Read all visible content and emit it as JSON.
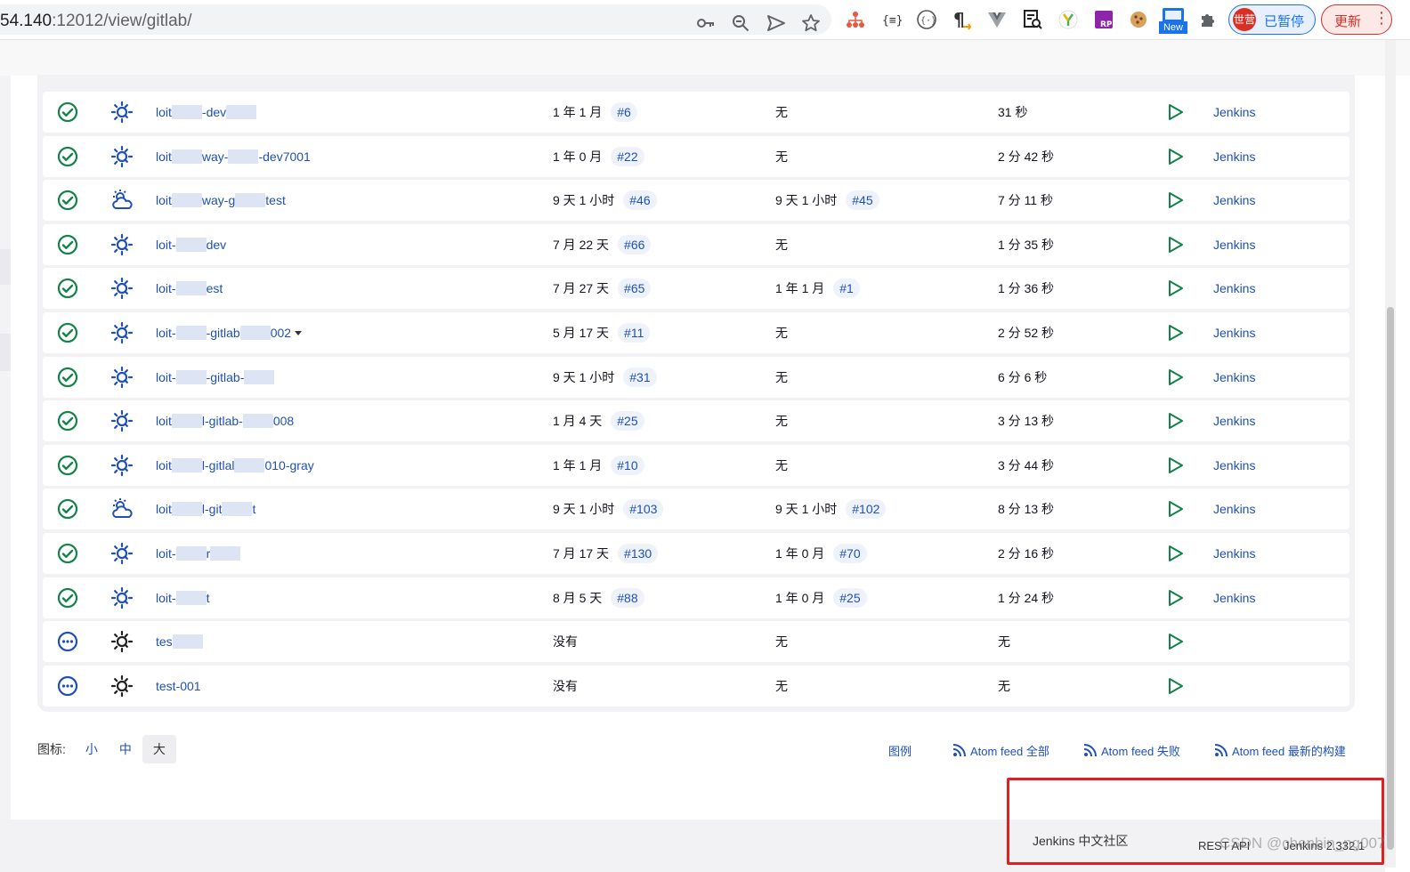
{
  "browser": {
    "url_host": "54.140",
    "url_rest": ":12012/view/gitlab/",
    "profile_avatar": "世营",
    "profile_label": "已暂停",
    "update_label": "更新",
    "ext_new_label": "New"
  },
  "jobs": [
    {
      "status": "success",
      "weather": "sunny",
      "name_parts": [
        "loit",
        "-dev",
        ""
      ],
      "last_success": "1 年 1 月",
      "last_success_build": "#6",
      "last_failure": "无",
      "last_failure_build": "",
      "duration": "31 秒",
      "node": "Jenkins"
    },
    {
      "status": "success",
      "weather": "sunny",
      "name_parts": [
        "loit",
        "way-",
        "-dev7001"
      ],
      "last_success": "1 年 0 月",
      "last_success_build": "#22",
      "last_failure": "无",
      "last_failure_build": "",
      "duration": "2 分 42 秒",
      "node": "Jenkins"
    },
    {
      "status": "success",
      "weather": "partly-cloudy",
      "name_parts": [
        "loit",
        "way-g",
        "test"
      ],
      "last_success": "9 天 1 小时",
      "last_success_build": "#46",
      "last_failure": "9 天 1 小时",
      "last_failure_build": "#45",
      "duration": "7 分 11 秒",
      "node": "Jenkins"
    },
    {
      "status": "success",
      "weather": "sunny",
      "name_parts": [
        "loit-",
        "dev"
      ],
      "last_success": "7 月 22 天",
      "last_success_build": "#66",
      "last_failure": "无",
      "last_failure_build": "",
      "duration": "1 分 35 秒",
      "node": "Jenkins"
    },
    {
      "status": "success",
      "weather": "sunny",
      "name_parts": [
        "loit-",
        "est"
      ],
      "last_success": "7 月 27 天",
      "last_success_build": "#65",
      "last_failure": "1 年 1 月",
      "last_failure_build": "#1",
      "duration": "1 分 36 秒",
      "node": "Jenkins"
    },
    {
      "status": "success",
      "weather": "sunny",
      "name_parts": [
        "loit-",
        "-gitlab",
        "002"
      ],
      "last_success": "5 月 17 天",
      "last_success_build": "#11",
      "last_failure": "无",
      "last_failure_build": "",
      "duration": "2 分 52 秒",
      "node": "Jenkins",
      "dropdown": true
    },
    {
      "status": "success",
      "weather": "sunny",
      "name_parts": [
        "loit-",
        "-gitlab-",
        ""
      ],
      "last_success": "9 天 1 小时",
      "last_success_build": "#31",
      "last_failure": "无",
      "last_failure_build": "",
      "duration": "6 分 6 秒",
      "node": "Jenkins"
    },
    {
      "status": "success",
      "weather": "sunny",
      "name_parts": [
        "loit",
        "l-gitlab-",
        "008"
      ],
      "last_success": "1 月 4 天",
      "last_success_build": "#25",
      "last_failure": "无",
      "last_failure_build": "",
      "duration": "3 分 13 秒",
      "node": "Jenkins"
    },
    {
      "status": "success",
      "weather": "sunny",
      "name_parts": [
        "loit",
        "l-gitlal",
        "010-gray"
      ],
      "last_success": "1 年 1 月",
      "last_success_build": "#10",
      "last_failure": "无",
      "last_failure_build": "",
      "duration": "3 分 44 秒",
      "node": "Jenkins"
    },
    {
      "status": "success",
      "weather": "partly-cloudy",
      "name_parts": [
        "loit",
        "l-git",
        "t"
      ],
      "last_success": "9 天 1 小时",
      "last_success_build": "#103",
      "last_failure": "9 天 1 小时",
      "last_failure_build": "#102",
      "duration": "8 分 13 秒",
      "node": "Jenkins"
    },
    {
      "status": "success",
      "weather": "sunny",
      "name_parts": [
        "loit-",
        "r",
        ""
      ],
      "last_success": "7 月 17 天",
      "last_success_build": "#130",
      "last_failure": "1 年 0 月",
      "last_failure_build": "#70",
      "duration": "2 分 16 秒",
      "node": "Jenkins"
    },
    {
      "status": "success",
      "weather": "sunny",
      "name_parts": [
        "loit-",
        "t"
      ],
      "last_success": "8 月 5 天",
      "last_success_build": "#88",
      "last_failure": "1 年 0 月",
      "last_failure_build": "#25",
      "duration": "1 分 24 秒",
      "node": "Jenkins"
    },
    {
      "status": "not-built",
      "weather": "sunny-dark",
      "name_parts": [
        "tes",
        ""
      ],
      "last_success": "没有",
      "last_success_build": "",
      "last_failure": "无",
      "last_failure_build": "",
      "duration": "无",
      "node": ""
    },
    {
      "status": "not-built",
      "weather": "sunny-dark",
      "name_parts": [
        "test-001"
      ],
      "last_success": "没有",
      "last_success_build": "",
      "last_failure": "无",
      "last_failure_build": "",
      "duration": "无",
      "node": ""
    }
  ],
  "icon_size": {
    "label": "图标:",
    "small": "小",
    "medium": "中",
    "large": "大",
    "selected": "large"
  },
  "feeds": {
    "legend": "图例",
    "all": "Atom feed 全部",
    "failed": "Atom feed 失败",
    "latest": "Atom feed 最新的构建"
  },
  "footer": {
    "community": "Jenkins 中文社区",
    "rest_api": "REST API",
    "version": "Jenkins 2.332.1"
  },
  "watermark": "CSDN @chenbin_ng007",
  "colors": {
    "link": "#1f50b8",
    "success": "#138347",
    "notbuilt": "#1f50b8",
    "run": "#138347",
    "highlight_box": "#e02020"
  }
}
